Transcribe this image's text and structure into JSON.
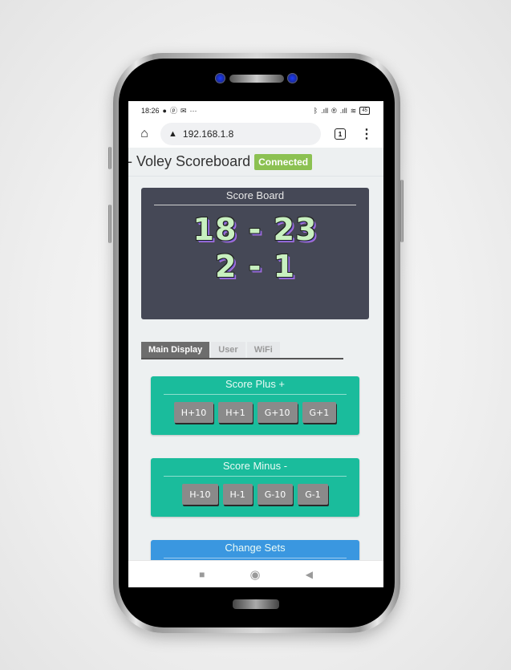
{
  "status_bar": {
    "time": "18:26",
    "left_icons": [
      "s-app-icon",
      "p-app-icon",
      "mail-icon",
      "more-dots-icon"
    ],
    "right_icons": [
      "bluetooth-icon",
      "signal-icon",
      "r-icon",
      "signal-icon",
      "wifi-icon"
    ],
    "battery": "45"
  },
  "browser": {
    "url": "192.168.1.8",
    "tab_count": "1",
    "icons": {
      "home": "⌂",
      "warning": "▲",
      "menu": "⋮"
    }
  },
  "header": {
    "title": "- Voley Scoreboard",
    "status": "Connected",
    "status_color": "#8cc152"
  },
  "scoreboard": {
    "title": "Score Board",
    "points": "18 - 23",
    "sets": "2 - 1"
  },
  "tabs": [
    {
      "label": "Main Display",
      "active": true
    },
    {
      "label": "User",
      "active": false
    },
    {
      "label": "WiFi",
      "active": false
    }
  ],
  "panels": {
    "plus": {
      "title": "Score Plus +",
      "color": "#1abc9c",
      "buttons": [
        "H+10",
        "H+1",
        "G+10",
        "G+1"
      ]
    },
    "minus": {
      "title": "Score Minus -",
      "color": "#1abc9c",
      "buttons": [
        "H-10",
        "H-1",
        "G-10",
        "G-1"
      ]
    },
    "sets": {
      "title": "Change Sets",
      "color": "#3a97e0"
    }
  },
  "nav": {
    "recent": "■",
    "home": "◉",
    "back": "◀"
  }
}
